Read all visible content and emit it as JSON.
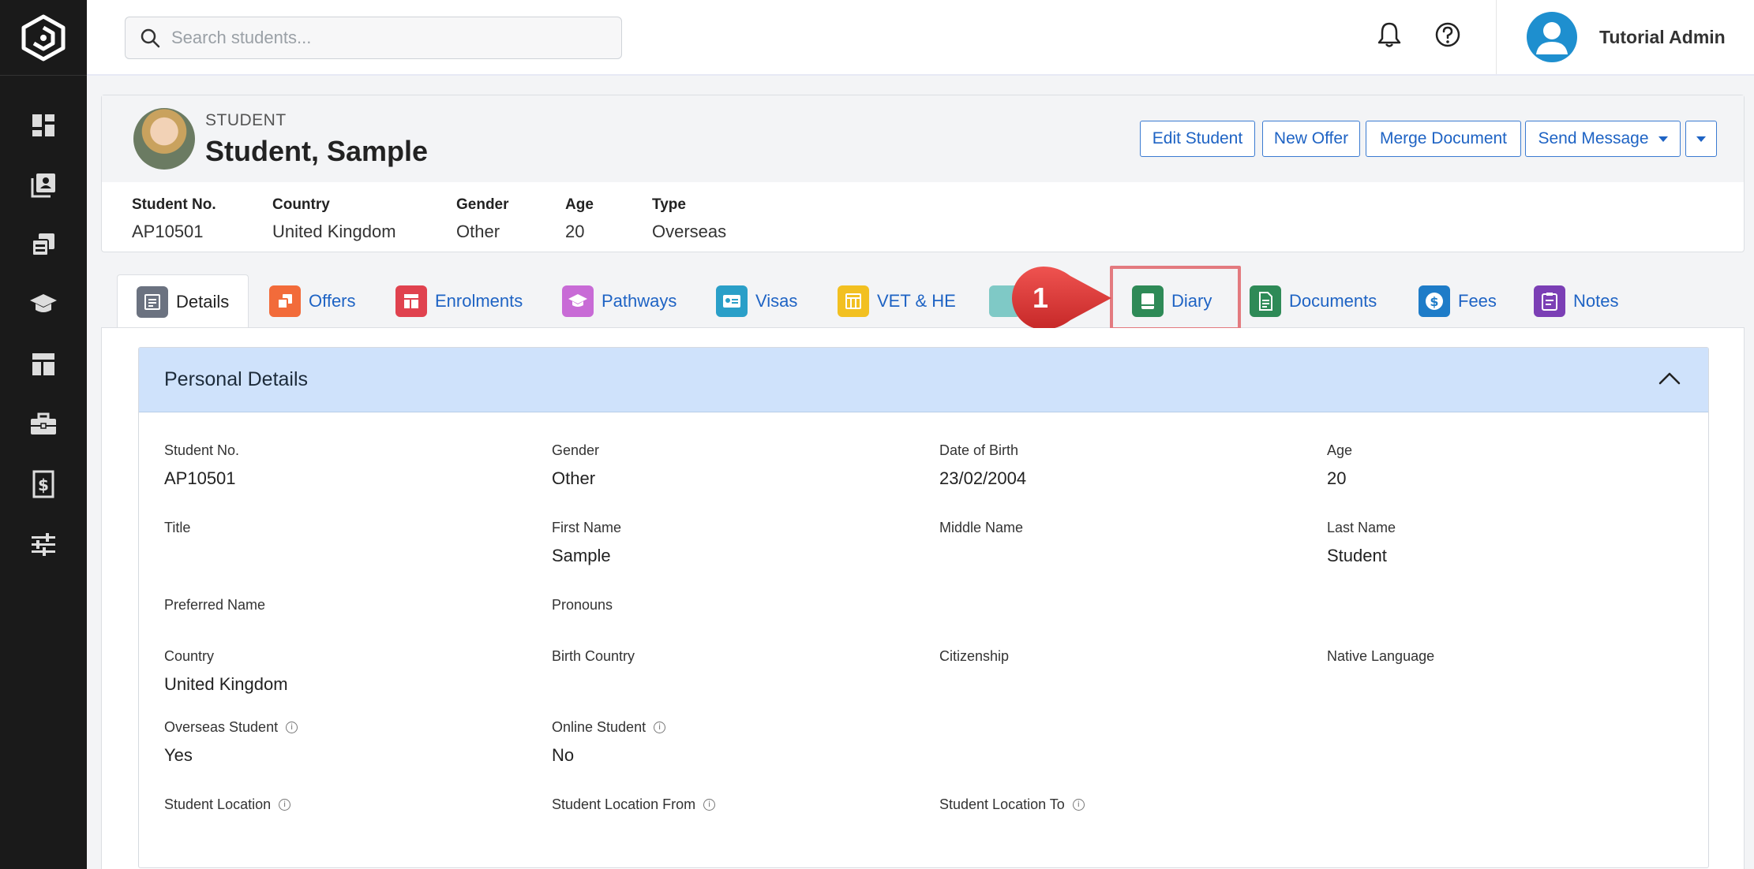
{
  "app": {
    "search_placeholder": "Search students...",
    "user_name": "Tutorial Admin"
  },
  "student": {
    "label": "STUDENT",
    "name": "Student, Sample",
    "buttons": {
      "edit": "Edit Student",
      "new_offer": "New Offer",
      "merge": "Merge Document",
      "send_message": "Send Message"
    },
    "meta": [
      {
        "key": "Student No.",
        "value": "AP10501"
      },
      {
        "key": "Country",
        "value": "United Kingdom"
      },
      {
        "key": "Gender",
        "value": "Other"
      },
      {
        "key": "Age",
        "value": "20"
      },
      {
        "key": "Type",
        "value": "Overseas"
      }
    ]
  },
  "tabs": [
    {
      "label": "Details",
      "color": "#6b7280"
    },
    {
      "label": "Offers",
      "color": "#f26b3a"
    },
    {
      "label": "Enrolments",
      "color": "#e0424f"
    },
    {
      "label": "Pathways",
      "color": "#c86bd6"
    },
    {
      "label": "Visas",
      "color": "#2a9fc8"
    },
    {
      "label": "VET & HE",
      "color": "#f2c021"
    },
    {
      "label": "",
      "color": "#7fc9c6"
    },
    {
      "label": "Diary",
      "color": "#2e8a57"
    },
    {
      "label": "Documents",
      "color": "#2e8a57"
    },
    {
      "label": "Fees",
      "color": "#1e7cc8"
    },
    {
      "label": "Notes",
      "color": "#7b3fb5"
    }
  ],
  "callout": {
    "number": "1"
  },
  "personal": {
    "title": "Personal Details",
    "fields": {
      "student_no": {
        "label": "Student No.",
        "value": "AP10501"
      },
      "gender": {
        "label": "Gender",
        "value": "Other"
      },
      "dob": {
        "label": "Date of Birth",
        "value": "23/02/2004"
      },
      "age": {
        "label": "Age",
        "value": "20"
      },
      "title": {
        "label": "Title",
        "value": ""
      },
      "first_name": {
        "label": "First Name",
        "value": "Sample"
      },
      "middle_name": {
        "label": "Middle Name",
        "value": ""
      },
      "last_name": {
        "label": "Last Name",
        "value": "Student"
      },
      "preferred_name": {
        "label": "Preferred Name",
        "value": ""
      },
      "pronouns": {
        "label": "Pronouns",
        "value": ""
      },
      "country": {
        "label": "Country",
        "value": "United Kingdom"
      },
      "birth_country": {
        "label": "Birth Country",
        "value": ""
      },
      "citizenship": {
        "label": "Citizenship",
        "value": ""
      },
      "native_language": {
        "label": "Native Language",
        "value": ""
      },
      "overseas_student": {
        "label": "Overseas Student",
        "value": "Yes"
      },
      "online_student": {
        "label": "Online Student",
        "value": "No"
      },
      "student_location": {
        "label": "Student Location",
        "value": ""
      },
      "student_location_from": {
        "label": "Student Location From",
        "value": ""
      },
      "student_location_to": {
        "label": "Student Location To",
        "value": ""
      }
    }
  }
}
